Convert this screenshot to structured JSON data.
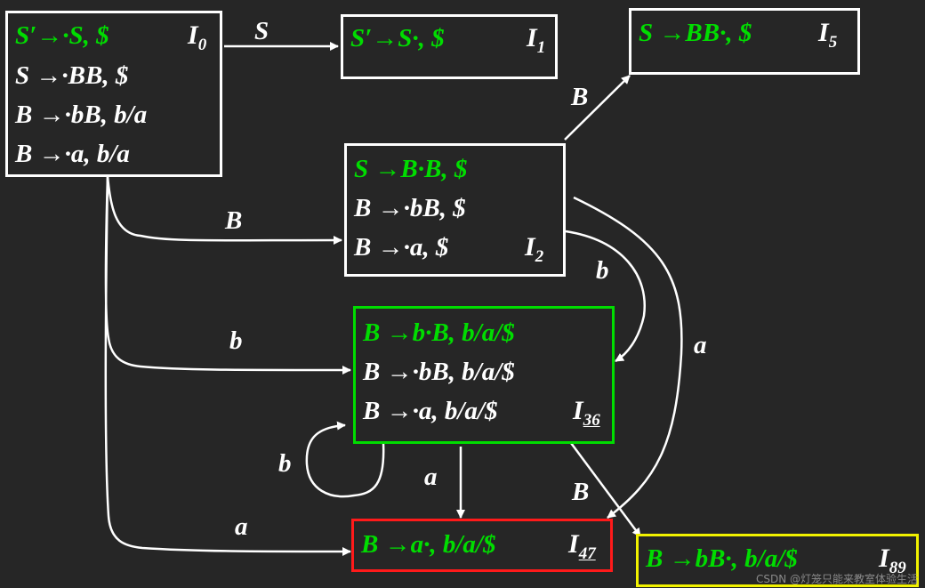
{
  "states": [
    {
      "id": "I0",
      "name": "I",
      "sub": "0",
      "underline": false,
      "color": "#ffffff",
      "items": [
        {
          "text": "S′→·S, $",
          "kernel": true
        },
        {
          "text": "S →·BB, $",
          "kernel": false
        },
        {
          "text": "B →·bB, b/a",
          "kernel": false
        },
        {
          "text": "B →·a, b/a",
          "kernel": false
        }
      ]
    },
    {
      "id": "I1",
      "name": "I",
      "sub": "1",
      "underline": false,
      "color": "#ffffff",
      "items": [
        {
          "text": "S′→S·, $",
          "kernel": true
        }
      ]
    },
    {
      "id": "I5",
      "name": "I",
      "sub": "5",
      "underline": false,
      "color": "#ffffff",
      "items": [
        {
          "text": "S →BB·, $",
          "kernel": true
        }
      ]
    },
    {
      "id": "I2",
      "name": "I",
      "sub": "2",
      "underline": false,
      "color": "#ffffff",
      "items": [
        {
          "text": "S →B·B, $",
          "kernel": true
        },
        {
          "text": "B →·bB, $",
          "kernel": false
        },
        {
          "text": "B →·a, $",
          "kernel": false
        }
      ]
    },
    {
      "id": "I36",
      "name": "I",
      "sub": "36",
      "underline": true,
      "color": "#00dd00",
      "items": [
        {
          "text": "B →b·B, b/a/$",
          "kernel": true
        },
        {
          "text": "B →·bB, b/a/$",
          "kernel": false
        },
        {
          "text": "B →·a, b/a/$",
          "kernel": false
        }
      ]
    },
    {
      "id": "I47",
      "name": "I",
      "sub": "47",
      "underline": true,
      "color": "#ff1a1a",
      "items": [
        {
          "text": "B →a·, b/a/$",
          "kernel": true
        }
      ]
    },
    {
      "id": "I89",
      "name": "I",
      "sub": "89",
      "underline": false,
      "color": "#f2f200",
      "items": [
        {
          "text": "B →bB·, b/a/$",
          "kernel": true
        }
      ]
    }
  ],
  "transitions": [
    {
      "from": "I0",
      "to": "I1",
      "symbol": "S"
    },
    {
      "from": "I0",
      "to": "I2",
      "symbol": "B"
    },
    {
      "from": "I0",
      "to": "I36",
      "symbol": "b"
    },
    {
      "from": "I0",
      "to": "I47",
      "symbol": "a"
    },
    {
      "from": "I2",
      "to": "I5",
      "symbol": "B"
    },
    {
      "from": "I2",
      "to": "I36",
      "symbol": "b"
    },
    {
      "from": "I2",
      "to": "I47",
      "symbol": "a"
    },
    {
      "from": "I36",
      "to": "I36",
      "symbol": "b"
    },
    {
      "from": "I36",
      "to": "I47",
      "symbol": "a"
    },
    {
      "from": "I36",
      "to": "I89",
      "symbol": "B"
    }
  ],
  "colors": {
    "background": "#262626",
    "kernel": "#00dd00",
    "edge": "#ffffff"
  },
  "watermark": "CSDN @灯笼只能来教室体验生活"
}
